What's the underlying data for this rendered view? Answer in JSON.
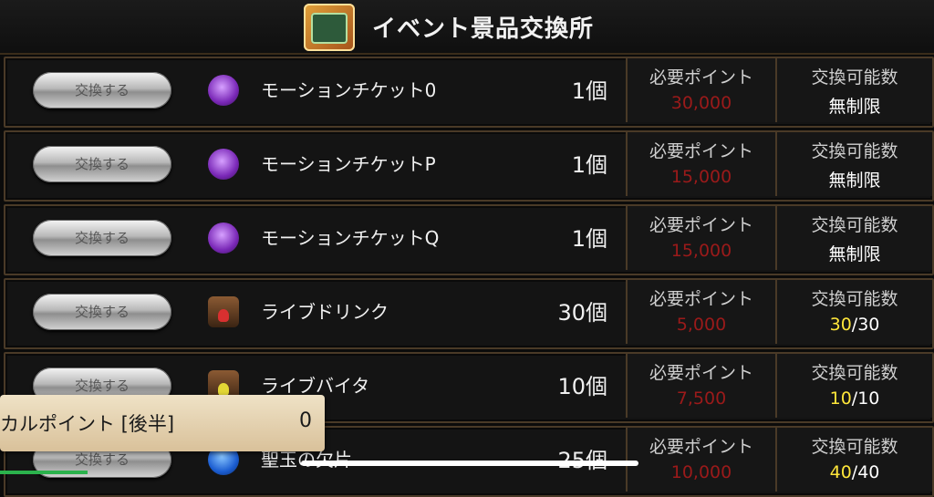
{
  "header": {
    "title": "イベント景品交換所",
    "icon": "exchange-chest-icon"
  },
  "columns": {
    "points_label": "必要ポイント",
    "limit_label": "交換可能数"
  },
  "rows": [
    {
      "button": "交換する",
      "icon": "motion-ticket-icon",
      "name": "モーションチケット0",
      "qty": "1個",
      "points": "30,000",
      "limit_text": "無制限"
    },
    {
      "button": "交換する",
      "icon": "motion-ticket-icon",
      "name": "モーションチケットP",
      "qty": "1個",
      "points": "15,000",
      "limit_text": "無制限"
    },
    {
      "button": "交換する",
      "icon": "motion-ticket-icon",
      "name": "モーションチケットQ",
      "qty": "1個",
      "points": "15,000",
      "limit_text": "無制限"
    },
    {
      "button": "交換する",
      "icon": "live-drink-icon",
      "name": "ライブドリンク",
      "qty": "30個",
      "points": "5,000",
      "limit_current": "30",
      "limit_total": "/30"
    },
    {
      "button": "交換する",
      "icon": "live-vita-icon",
      "name": "ライブバイタ",
      "qty": "10個",
      "points": "7,500",
      "limit_current": "10",
      "limit_total": "/10"
    },
    {
      "button": "交換する",
      "icon": "gem-fragment-icon",
      "name": "聖玉の欠片",
      "qty": "25個",
      "points": "10,000",
      "limit_current": "40",
      "limit_total": "/40"
    }
  ],
  "overlay": {
    "label": "カルポイント [後半]",
    "value": "0"
  },
  "colors": {
    "points": "#9b1a1a",
    "limit_current": "#ffe63a",
    "frame": "#4a3a27"
  }
}
